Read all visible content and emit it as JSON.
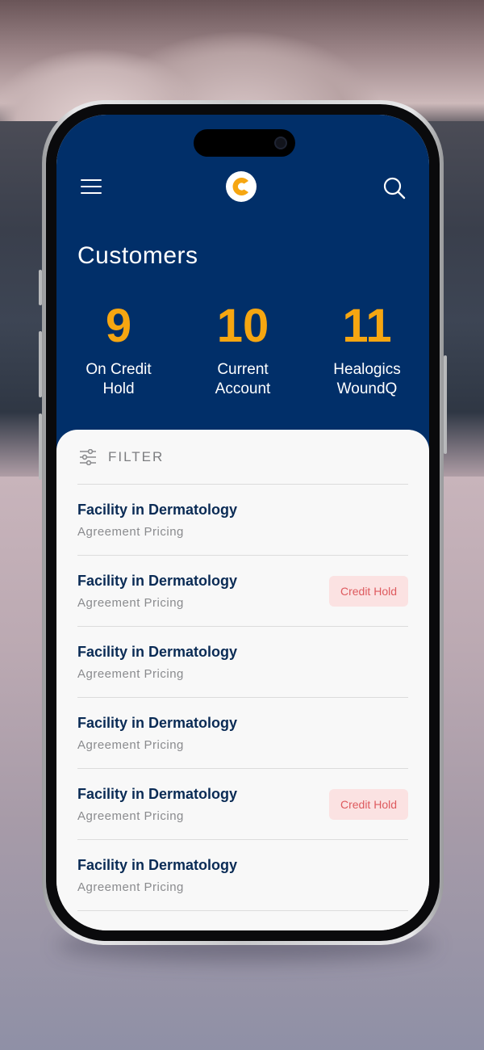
{
  "header": {
    "title": "Customers",
    "logo_icon": "brand-c-logo-icon",
    "menu_icon": "hamburger-menu-icon",
    "search_icon": "search-icon"
  },
  "stats": [
    {
      "value": "9",
      "label_line1": "On Credit",
      "label_line2": "Hold"
    },
    {
      "value": "10",
      "label_line1": "Current",
      "label_line2": "Account"
    },
    {
      "value": "11",
      "label_line1": "Healogics",
      "label_line2": "WoundQ"
    }
  ],
  "filter": {
    "label": "FILTER",
    "icon": "sliders-icon"
  },
  "customers": [
    {
      "name": "Facility in Dermatology",
      "subtitle": "Agreement Pricing",
      "badge": ""
    },
    {
      "name": "Facility in Dermatology",
      "subtitle": "Agreement Pricing",
      "badge": "Credit Hold"
    },
    {
      "name": "Facility in Dermatology",
      "subtitle": "Agreement Pricing",
      "badge": ""
    },
    {
      "name": "Facility in Dermatology",
      "subtitle": "Agreement Pricing",
      "badge": ""
    },
    {
      "name": "Facility in Dermatology",
      "subtitle": "Agreement Pricing",
      "badge": "Credit Hold"
    },
    {
      "name": "Facility in Dermatology",
      "subtitle": "Agreement Pricing",
      "badge": ""
    }
  ],
  "colors": {
    "header_bg": "#012f69",
    "accent": "#f6a611",
    "badge_bg": "#fbe2e2",
    "badge_text": "#de5a5e"
  }
}
